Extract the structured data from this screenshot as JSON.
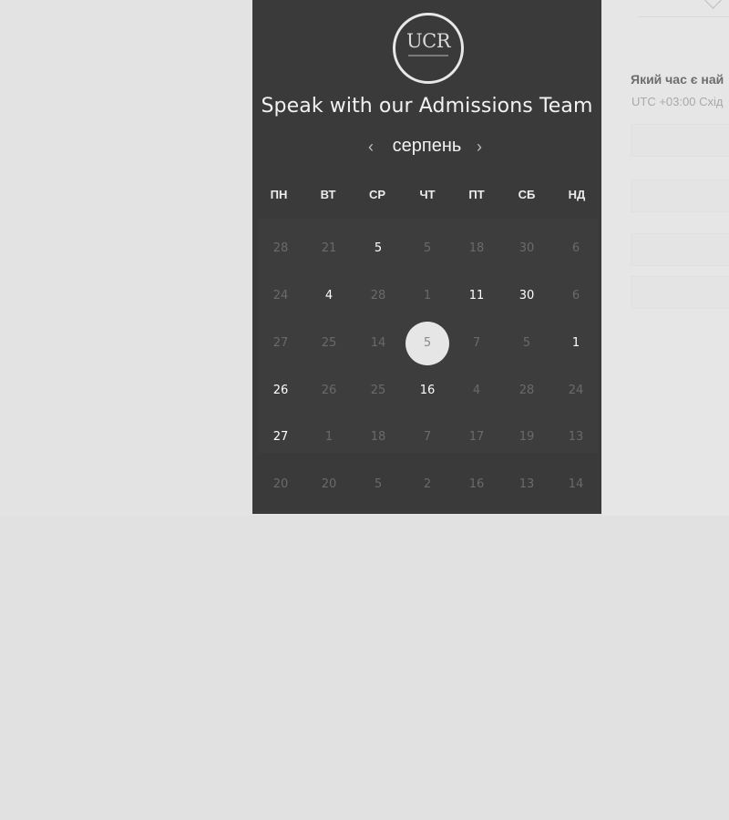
{
  "widget": {
    "logo_text": "UCR",
    "title": "Speak with our Admissions Team",
    "month": "серпень",
    "prev_icon": "‹",
    "next_icon": "›"
  },
  "weekdays": [
    "ПН",
    "ВТ",
    "СР",
    "ЧТ",
    "ПТ",
    "СБ",
    "НД"
  ],
  "calendar": {
    "rows": [
      [
        {
          "d": "28",
          "a": false
        },
        {
          "d": "21",
          "a": false
        },
        {
          "d": "5",
          "a": true
        },
        {
          "d": "5",
          "a": false
        },
        {
          "d": "18",
          "a": false
        },
        {
          "d": "30",
          "a": false
        },
        {
          "d": "6",
          "a": false
        }
      ],
      [
        {
          "d": "24",
          "a": false
        },
        {
          "d": "4",
          "a": true
        },
        {
          "d": "28",
          "a": false
        },
        {
          "d": "1",
          "a": false
        },
        {
          "d": "11",
          "a": true
        },
        {
          "d": "30",
          "a": true
        },
        {
          "d": "6",
          "a": false
        }
      ],
      [
        {
          "d": "27",
          "a": false
        },
        {
          "d": "25",
          "a": false
        },
        {
          "d": "14",
          "a": false
        },
        {
          "d": "5",
          "a": false,
          "selected": true
        },
        {
          "d": "7",
          "a": false
        },
        {
          "d": "5",
          "a": false
        },
        {
          "d": "1",
          "a": true
        }
      ],
      [
        {
          "d": "26",
          "a": true
        },
        {
          "d": "26",
          "a": false
        },
        {
          "d": "25",
          "a": false
        },
        {
          "d": "16",
          "a": true
        },
        {
          "d": "4",
          "a": false
        },
        {
          "d": "28",
          "a": false
        },
        {
          "d": "24",
          "a": false
        }
      ],
      [
        {
          "d": "27",
          "a": true
        },
        {
          "d": "1",
          "a": false
        },
        {
          "d": "18",
          "a": false
        },
        {
          "d": "7",
          "a": false
        },
        {
          "d": "17",
          "a": false
        },
        {
          "d": "19",
          "a": false
        },
        {
          "d": "13",
          "a": false
        }
      ],
      [
        {
          "d": "20",
          "a": false
        },
        {
          "d": "20",
          "a": false
        },
        {
          "d": "5",
          "a": false
        },
        {
          "d": "2",
          "a": false
        },
        {
          "d": "16",
          "a": false
        },
        {
          "d": "13",
          "a": false
        },
        {
          "d": "14",
          "a": false
        }
      ]
    ]
  },
  "right_pane": {
    "question": "Який час є най",
    "timezone": "UTC +03:00 Схід"
  },
  "colors": {
    "panel_bg": "#3a3a3a",
    "page_bg": "#e1e1e1",
    "selected_day_bg": "#e6e6e6"
  }
}
